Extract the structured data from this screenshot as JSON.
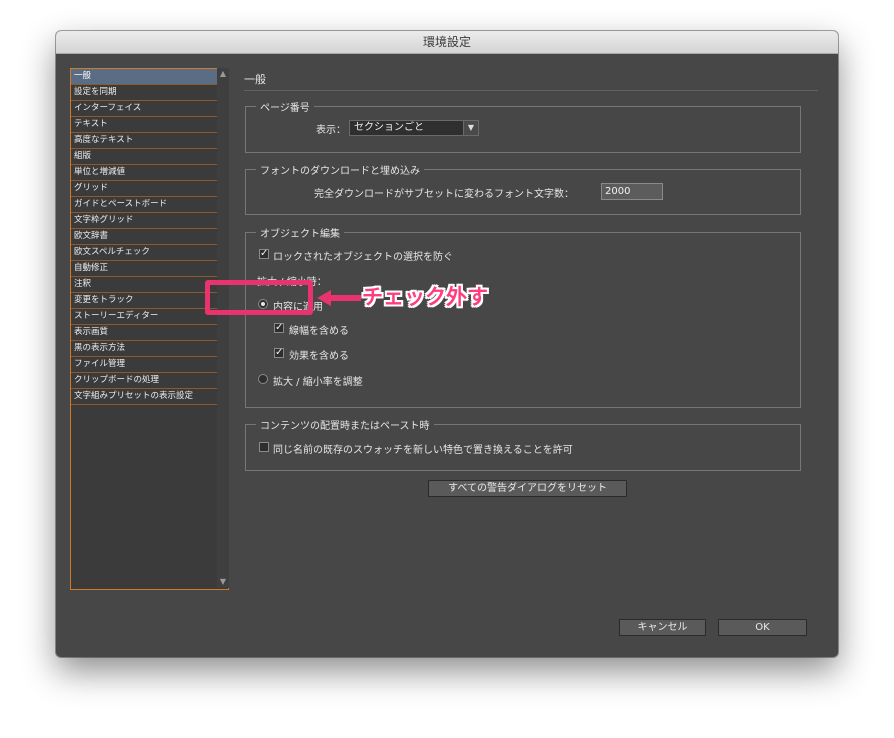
{
  "window": {
    "title": "環境設定"
  },
  "sidebar": {
    "items": [
      {
        "label": "一般"
      },
      {
        "label": "設定を同期"
      },
      {
        "label": "インターフェイス"
      },
      {
        "label": "テキスト"
      },
      {
        "label": "高度なテキスト"
      },
      {
        "label": "組版"
      },
      {
        "label": "単位と増減値"
      },
      {
        "label": "グリッド"
      },
      {
        "label": "ガイドとペーストボード"
      },
      {
        "label": "文字枠グリッド"
      },
      {
        "label": "欧文辞書"
      },
      {
        "label": "欧文スペルチェック"
      },
      {
        "label": "自動修正"
      },
      {
        "label": "注釈"
      },
      {
        "label": "変更をトラック"
      },
      {
        "label": "ストーリーエディター"
      },
      {
        "label": "表示画質"
      },
      {
        "label": "黒の表示方法"
      },
      {
        "label": "ファイル管理"
      },
      {
        "label": "クリップボードの処理"
      },
      {
        "label": "文字組みプリセットの表示設定"
      }
    ]
  },
  "main": {
    "title": "一般",
    "page_number": {
      "legend": "ページ番号",
      "display_label": "表示：",
      "display_value": "セクションごと"
    },
    "font_download": {
      "legend": "フォントのダウンロードと埋め込み",
      "threshold_label": "完全ダウンロードがサブセットに変わるフォント文字数：",
      "threshold_value": "2000"
    },
    "object_editing": {
      "legend": "オブジェクト編集",
      "prevent_locked_label": "ロックされたオブジェクトの選択を防ぐ",
      "prevent_locked_checked": true,
      "scaling_label": "拡大 / 縮小時：",
      "apply_to_content_label": "内容に適用",
      "include_stroke_label": "線幅を含める",
      "include_stroke_checked": true,
      "include_effects_label": "効果を含める",
      "include_effects_checked": true,
      "adjust_scale_label": "拡大 / 縮小率を調整",
      "selected_option": "apply_to_content"
    },
    "paste": {
      "legend": "コンテンツの配置時またはペースト時",
      "replace_swatch_label": "同じ名前の既存のスウォッチを新しい特色で置き換えることを許可",
      "replace_swatch_checked": false
    },
    "reset_warnings_label": "すべての警告ダイアログをリセット"
  },
  "footer": {
    "cancel_label": "キャンセル",
    "ok_label": "OK"
  },
  "annotation": {
    "text": "チェック外す",
    "color": "#e8336f"
  },
  "icons": {
    "check": "✓",
    "select_arrow": "▼",
    "scroll_up": "▲",
    "scroll_down": "▼"
  }
}
